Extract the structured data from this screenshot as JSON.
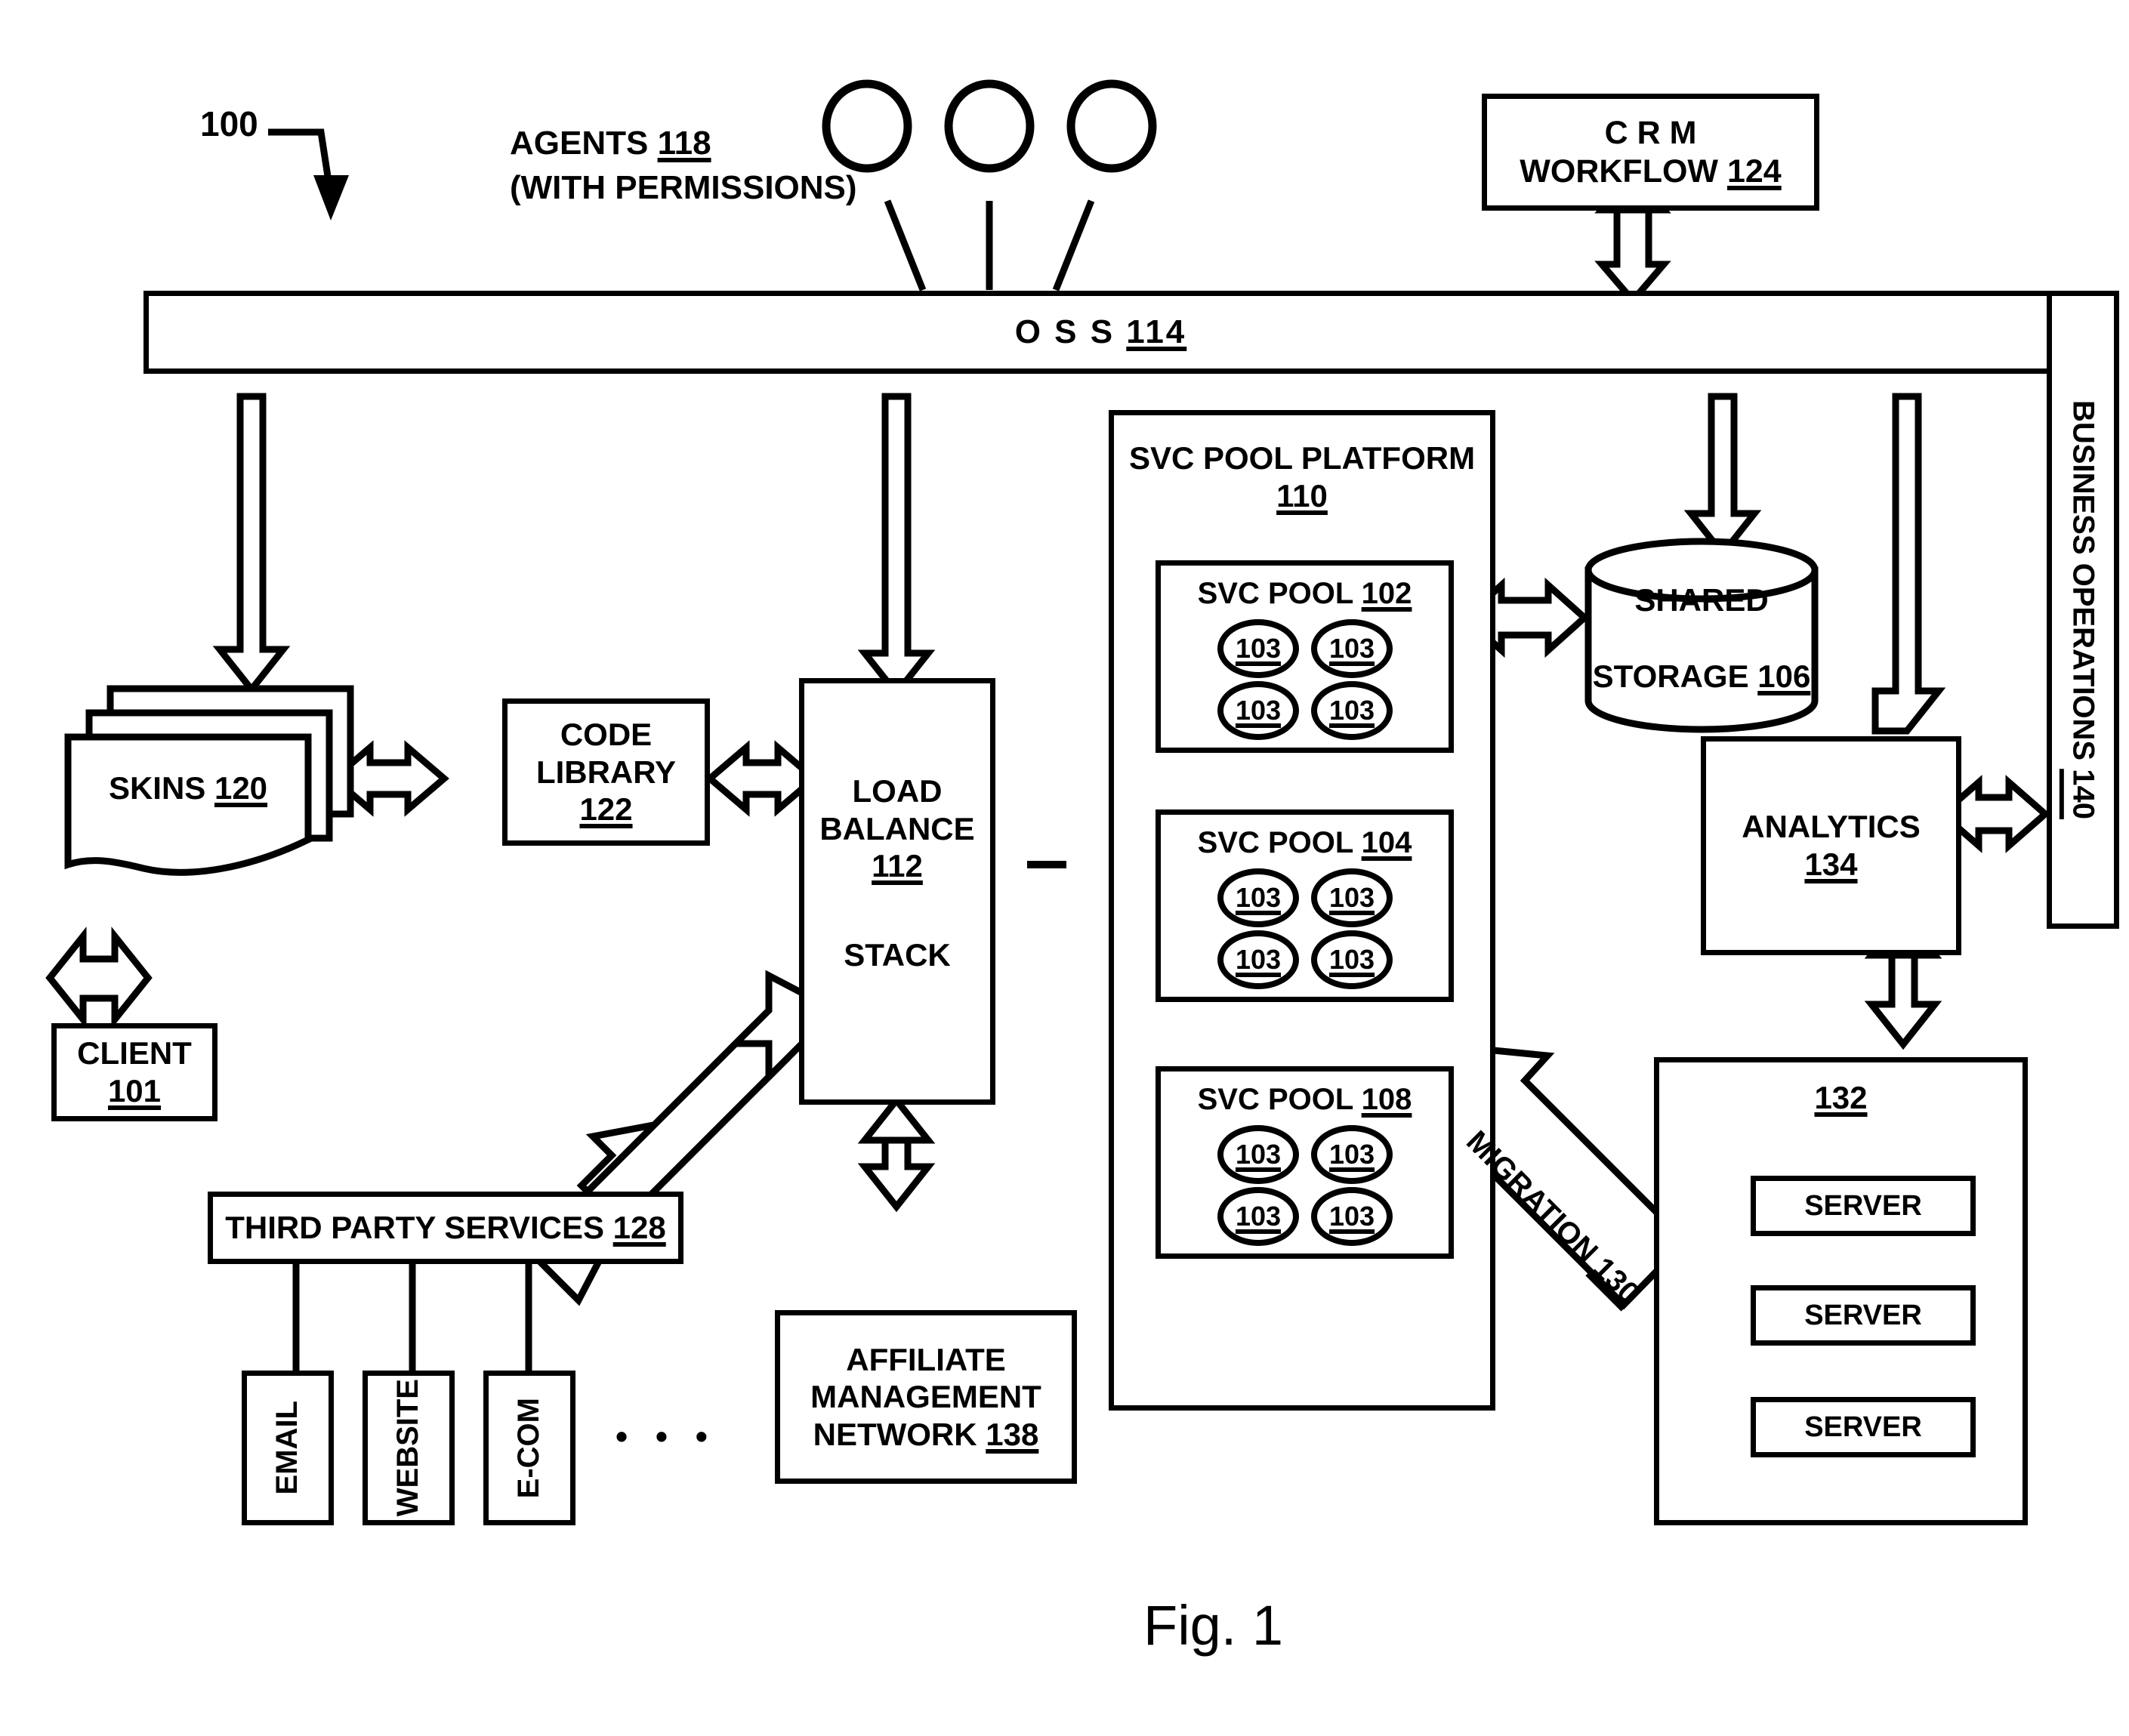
{
  "figure": {
    "caption": "Fig. 1",
    "system_ref": "100"
  },
  "labels": {
    "agents_line1": "AGENTS ",
    "agents_ref": "118",
    "agents_line2": "(WITH PERMISSIONS)",
    "agents_count": 3
  },
  "nodes": {
    "crm_workflow": {
      "line1": "C R M",
      "line2": "WORKFLOW ",
      "ref": "124"
    },
    "oss": {
      "text": "O S S ",
      "ref": "114"
    },
    "business_operations": {
      "text": "BUSINESS OPERATIONS ",
      "ref": "140"
    },
    "skins": {
      "text": "SKINS ",
      "ref": "120"
    },
    "client": {
      "text": "CLIENT",
      "ref": "101"
    },
    "code_library": {
      "line1": "CODE",
      "line2": "LIBRARY",
      "ref": "122"
    },
    "load_balance": {
      "line1": "LOAD",
      "line2": "BALANCE",
      "ref": "112",
      "line3": "STACK"
    },
    "third_party_services": {
      "text": "THIRD PARTY SERVICES ",
      "ref": "128"
    },
    "third_party_children": [
      "EMAIL",
      "WEBSITE",
      "E-COM"
    ],
    "third_party_ellipsis": "• • •",
    "affiliate_network": {
      "line1": "AFFILIATE",
      "line2": "MANAGEMENT",
      "line3": "NETWORK ",
      "ref": "138"
    },
    "svc_pool_platform": {
      "text": "SVC POOL PLATFORM",
      "ref": "110"
    },
    "svc_pools": [
      {
        "label": "SVC POOL ",
        "ref": "102",
        "nodes": [
          "103",
          "103",
          "103",
          "103"
        ]
      },
      {
        "label": "SVC POOL ",
        "ref": "104",
        "nodes": [
          "103",
          "103",
          "103",
          "103"
        ]
      },
      {
        "label": "SVC POOL ",
        "ref": "108",
        "nodes": [
          "103",
          "103",
          "103",
          "103"
        ]
      }
    ],
    "shared_storage": {
      "line1": "SHARED",
      "line2": "STORAGE ",
      "ref": "106"
    },
    "analytics": {
      "line1": "ANALYTICS",
      "ref": "134"
    },
    "server_group": {
      "ref": "132",
      "servers": [
        "SERVER",
        "SERVER",
        "SERVER"
      ]
    },
    "migration": {
      "text": "MIGRATION ",
      "ref": "130"
    }
  },
  "colors": {
    "stroke": "#000000",
    "fill": "#ffffff"
  }
}
